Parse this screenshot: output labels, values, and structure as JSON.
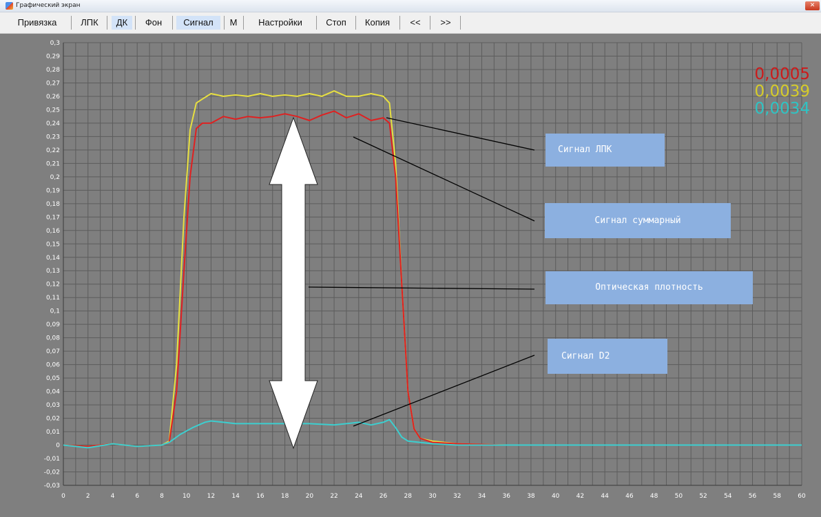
{
  "window": {
    "title": "Графический экран",
    "close_glyph": "✕"
  },
  "menu": [
    "Привязка",
    "ЛПК",
    "ДК",
    "Фон",
    "Сигнал",
    "М",
    "Настройки",
    "Стоп",
    "Копия",
    "<<",
    ">>"
  ],
  "menu_active": [
    "ДК",
    "Сигнал"
  ],
  "readouts": [
    {
      "value": "0,0005",
      "color": "#cc1a1a"
    },
    {
      "value": "0,0039",
      "color": "#d6cc2a"
    },
    {
      "value": "0,0034",
      "color": "#2ec4c4"
    }
  ],
  "callouts": {
    "lpk": "Сигнал ЛПК",
    "total": "Сигнал суммарный",
    "density": "Оптическая плотность",
    "d2": "Сигнал D2"
  },
  "colors": {
    "plot_bg": "#7f7f7f",
    "grid": "#5c5c5c",
    "red": "#e02020",
    "yellow": "#e8e040",
    "cyan": "#3ccfd0",
    "callout_bg": "#8cb0e0"
  },
  "chart_data": {
    "type": "line",
    "xlim": [
      0,
      60
    ],
    "ylim": [
      -0.03,
      0.3
    ],
    "x_ticks": [
      "0",
      "2",
      "4",
      "6",
      "8",
      "10",
      "12",
      "14",
      "16",
      "18",
      "20",
      "22",
      "24",
      "26",
      "28",
      "30",
      "32",
      "34",
      "36",
      "38",
      "40",
      "42",
      "44",
      "46",
      "48",
      "50",
      "52",
      "54",
      "56",
      "58",
      "60"
    ],
    "y_ticks": [
      "0,3",
      "0,29",
      "0,28",
      "0,27",
      "0,26",
      "0,25",
      "0,24",
      "0,23",
      "0,22",
      "0,21",
      "0,2",
      "0,19",
      "0,18",
      "0,17",
      "0,16",
      "0,15",
      "0,14",
      "0,13",
      "0,12",
      "0,11",
      "0,1",
      "0,09",
      "0,08",
      "0,07",
      "0,06",
      "0,05",
      "0,04",
      "0,03",
      "0,02",
      "0,01",
      "0",
      "-0,01",
      "-0,02",
      "-0,03"
    ],
    "grid": true,
    "series": [
      {
        "color": "#e02020",
        "x": [
          0,
          2,
          4,
          6,
          8,
          8.6,
          9.2,
          9.8,
          10.3,
          10.8,
          11.3,
          12,
          13,
          14,
          15,
          16,
          17,
          18,
          19,
          20,
          21,
          22,
          23,
          24,
          25,
          26,
          26.5,
          27,
          27.5,
          28,
          28.5,
          29,
          30,
          32,
          36,
          40,
          44,
          48,
          52,
          56,
          60
        ],
        "y": [
          0,
          -0.001,
          0.001,
          -0.001,
          0,
          0.002,
          0.04,
          0.13,
          0.2,
          0.236,
          0.24,
          0.24,
          0.245,
          0.243,
          0.245,
          0.244,
          0.245,
          0.247,
          0.245,
          0.242,
          0.246,
          0.249,
          0.244,
          0.247,
          0.242,
          0.244,
          0.24,
          0.2,
          0.12,
          0.04,
          0.012,
          0.005,
          0.002,
          0.001,
          0,
          0,
          0,
          0,
          0,
          0,
          0
        ]
      },
      {
        "color": "#e8e040",
        "x": [
          0,
          2,
          4,
          6,
          8,
          8.6,
          9.2,
          9.8,
          10.3,
          10.8,
          11.3,
          12,
          13,
          14,
          15,
          16,
          17,
          18,
          19,
          20,
          21,
          22,
          23,
          24,
          25,
          26,
          26.5,
          27,
          27.5,
          28,
          28.5,
          29,
          30,
          32,
          36,
          40,
          44,
          48,
          52,
          56,
          60
        ],
        "y": [
          0,
          -0.001,
          0.001,
          -0.001,
          0,
          0.003,
          0.06,
          0.17,
          0.235,
          0.255,
          0.258,
          0.262,
          0.26,
          0.261,
          0.26,
          0.262,
          0.26,
          0.261,
          0.26,
          0.262,
          0.26,
          0.264,
          0.26,
          0.26,
          0.262,
          0.26,
          0.255,
          0.21,
          0.12,
          0.04,
          0.012,
          0.005,
          0.003,
          0.001,
          0,
          0,
          0,
          0,
          0,
          0,
          0
        ]
      },
      {
        "color": "#3ccfd0",
        "x": [
          0,
          2,
          4,
          6,
          8,
          8.6,
          9.5,
          10.5,
          11.5,
          12,
          13,
          14,
          16,
          18,
          20,
          22,
          23,
          24,
          25,
          26,
          26.5,
          27,
          27.5,
          28,
          29,
          30,
          32,
          36,
          40,
          44,
          48,
          52,
          56,
          60
        ],
        "y": [
          0,
          -0.002,
          0.001,
          -0.001,
          0,
          0.002,
          0.008,
          0.013,
          0.017,
          0.018,
          0.017,
          0.016,
          0.016,
          0.016,
          0.016,
          0.015,
          0.016,
          0.017,
          0.015,
          0.017,
          0.019,
          0.013,
          0.006,
          0.003,
          0.002,
          0.001,
          0,
          0,
          0,
          0,
          0,
          0,
          0,
          0
        ]
      }
    ]
  }
}
